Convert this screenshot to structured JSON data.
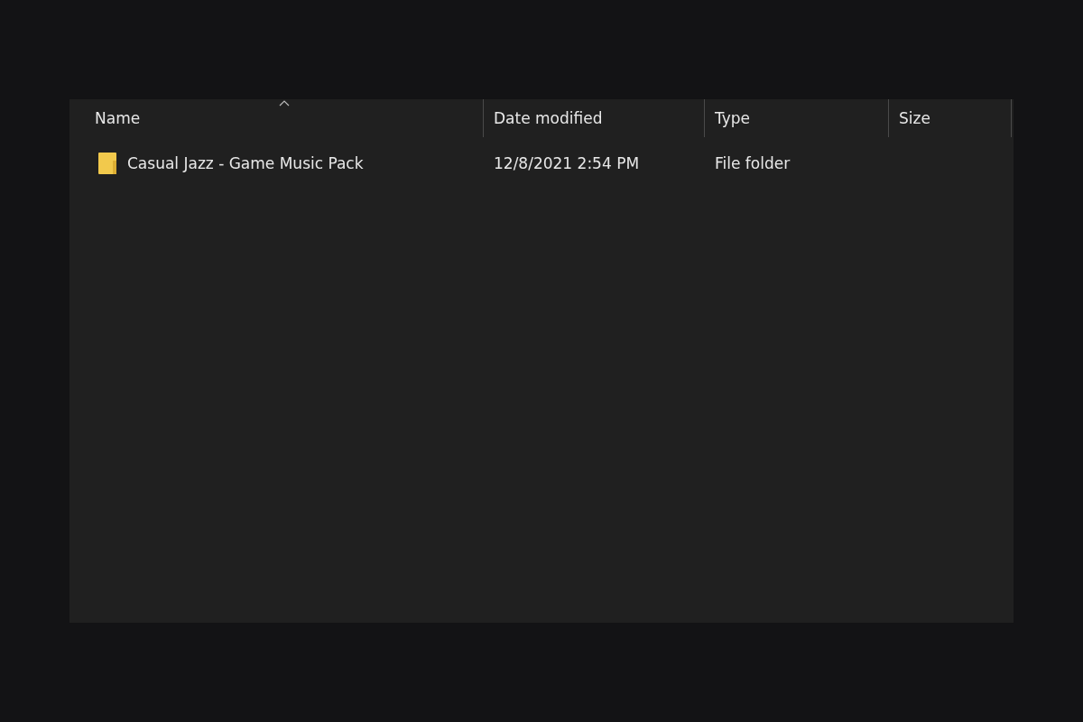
{
  "columns": [
    {
      "label": "Name",
      "sorted": true
    },
    {
      "label": "Date modified",
      "sorted": false
    },
    {
      "label": "Type",
      "sorted": false
    },
    {
      "label": "Size",
      "sorted": false
    }
  ],
  "rows": [
    {
      "kind": "folder",
      "name": "Casual Jazz - Game Music Pack",
      "date_modified": "12/8/2021 2:54 PM",
      "type": "File folder"
    }
  ]
}
